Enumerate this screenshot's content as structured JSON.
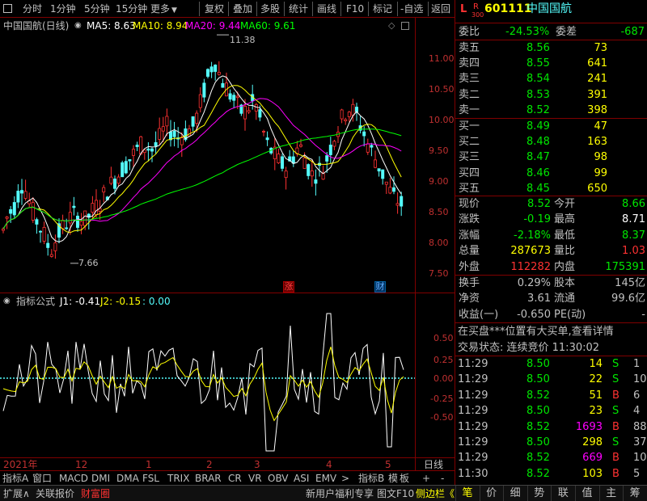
{
  "toolbar": {
    "left_icon": "menu-box",
    "periods": [
      "分时",
      "1分钟",
      "5分钟",
      "15分钟",
      "更多"
    ],
    "buttons": [
      "复权",
      "叠加",
      "多股",
      "统计",
      "画线",
      "F10",
      "标记",
      "-自选",
      "返回"
    ]
  },
  "chart_header": {
    "name": "中国国航(日线)",
    "ma5": "MA5: 8.63",
    "ma10": "MA10: 8.94",
    "ma20": "MA20: 9.44",
    "ma60": "MA60: 9.61",
    "high_label": "11.38",
    "low_label": "7.66",
    "tag_zhang": "涨",
    "tag_cai": "财"
  },
  "price_axis": [
    "11.00",
    "10.50",
    "10.00",
    "9.50",
    "9.00",
    "8.50",
    "8.00",
    "7.50"
  ],
  "indicator": {
    "title": "指标公式",
    "j1": "J1: -0.41",
    "j2": "J2: -0.15",
    "j3": ": 0.00",
    "axis": [
      "0.50",
      "0.25",
      "0.00",
      "-0.25",
      "-0.50"
    ]
  },
  "time_axis": {
    "labels": [
      "2021年",
      "12",
      "1",
      "2",
      "3",
      "4",
      "5"
    ],
    "period": "日线"
  },
  "bottom_tabs": [
    "指标A",
    "窗口",
    "MACD",
    "DMI",
    "DMA",
    "FSL",
    "TRIX",
    "BRAR",
    "CR",
    "VR",
    "OBV",
    "ASI",
    "EMV",
    ">",
    "指标B",
    "模",
    "板",
    "+",
    "-"
  ],
  "status_bar": {
    "expand": "扩展∧",
    "link": "关联报价",
    "active": "财富圈",
    "notice": "新用户福利专享",
    "f10": "图文F10",
    "side": "侧边栏《",
    "tabs": [
      "笔",
      "价",
      "细",
      "势",
      "联",
      "值",
      "主",
      "筹"
    ]
  },
  "quote": {
    "market_mark_l": "L",
    "market_mark_r": "R",
    "market_mark_300": "300",
    "code": "601111",
    "name": "中国国航",
    "weibi_label": "委比",
    "weibi": "-24.53%",
    "weicha_label": "委差",
    "weicha": "-687",
    "sells": [
      {
        "label": "卖五",
        "price": "8.56",
        "vol": "73"
      },
      {
        "label": "卖四",
        "price": "8.55",
        "vol": "641"
      },
      {
        "label": "卖三",
        "price": "8.54",
        "vol": "241"
      },
      {
        "label": "卖二",
        "price": "8.53",
        "vol": "391"
      },
      {
        "label": "卖一",
        "price": "8.52",
        "vol": "398"
      }
    ],
    "buys": [
      {
        "label": "买一",
        "price": "8.49",
        "vol": "47"
      },
      {
        "label": "买二",
        "price": "8.48",
        "vol": "163"
      },
      {
        "label": "买三",
        "price": "8.47",
        "vol": "98"
      },
      {
        "label": "买四",
        "price": "8.46",
        "vol": "99"
      },
      {
        "label": "买五",
        "price": "8.45",
        "vol": "650"
      }
    ],
    "stats1": [
      {
        "l1": "现价",
        "v1": "8.52",
        "l2": "今开",
        "v2": "8.66"
      },
      {
        "l1": "涨跌",
        "v1": "-0.19",
        "l2": "最高",
        "v2": "8.71"
      },
      {
        "l1": "涨幅",
        "v1": "-2.18%",
        "l2": "最低",
        "v2": "8.37"
      },
      {
        "l1": "总量",
        "v1": "287673",
        "l2": "量比",
        "v2": "1.03"
      },
      {
        "l1": "外盘",
        "v1": "112282",
        "l2": "内盘",
        "v2": "175391"
      }
    ],
    "stats2": [
      {
        "l1": "换手",
        "v1": "0.29%",
        "l2": "股本",
        "v2": "145亿"
      },
      {
        "l1": "净资",
        "v1": "3.61",
        "l2": "流通",
        "v2": "99.6亿"
      },
      {
        "l1": "收益(一)",
        "v1": "-0.650",
        "l2": "PE(动)",
        "v2": "-"
      }
    ],
    "notice": "在买盘***位置有大买单,查看详情",
    "trade_state": "交易状态: 连续竞价 11:30:02",
    "ticks": [
      {
        "t": "11:29",
        "p": "8.50",
        "v": "14",
        "f": "S",
        "n": "1"
      },
      {
        "t": "11:29",
        "p": "8.50",
        "v": "22",
        "f": "S",
        "n": "10"
      },
      {
        "t": "11:29",
        "p": "8.52",
        "v": "51",
        "f": "B",
        "n": "6"
      },
      {
        "t": "11:29",
        "p": "8.50",
        "v": "23",
        "f": "S",
        "n": "4"
      },
      {
        "t": "11:29",
        "p": "8.52",
        "v": "1693",
        "f": "B",
        "n": "88"
      },
      {
        "t": "11:29",
        "p": "8.50",
        "v": "298",
        "f": "S",
        "n": "37"
      },
      {
        "t": "11:29",
        "p": "8.52",
        "v": "669",
        "f": "B",
        "n": "10"
      },
      {
        "t": "11:30",
        "p": "8.52",
        "v": "103",
        "f": "B",
        "n": "5"
      }
    ]
  },
  "colors": {
    "up": "#ff3232",
    "down": "#54fcfc",
    "green": "#00e600",
    "yellow": "#ffff00",
    "ma5": "#ffffff",
    "ma10": "#ffff00",
    "ma20": "#ff00ff",
    "ma60": "#00ff00",
    "grid": "#800000"
  }
}
